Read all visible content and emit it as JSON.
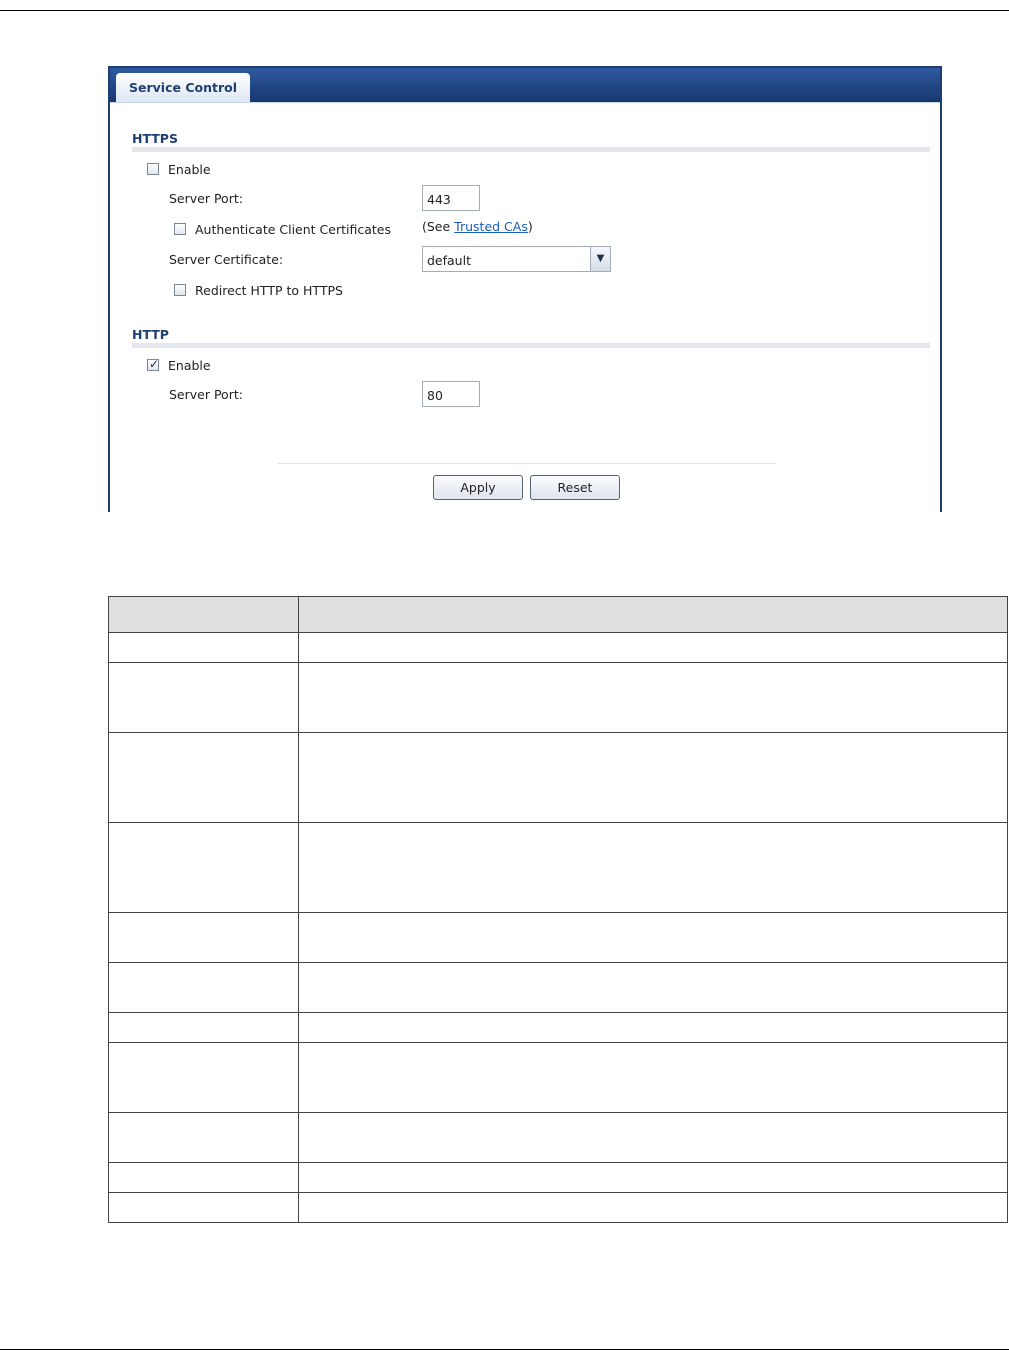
{
  "panel": {
    "tab_label": "Service Control",
    "https": {
      "title": "HTTPS",
      "enable_label": "Enable",
      "enable_checked": false,
      "server_port_label": "Server Port:",
      "server_port_value": "443",
      "auth_client_label": "Authenticate Client Certificates",
      "auth_client_checked": false,
      "see_prefix": "(See ",
      "trusted_cas_link": "Trusted CAs",
      "see_suffix": ")",
      "server_cert_label": "Server Certificate:",
      "server_cert_value": "default",
      "redirect_label": "Redirect HTTP to HTTPS",
      "redirect_checked": false
    },
    "http": {
      "title": "HTTP",
      "enable_label": "Enable",
      "enable_checked": true,
      "server_port_label": "Server Port:",
      "server_port_value": "80"
    },
    "buttons": {
      "apply": "Apply",
      "reset": "Reset"
    }
  },
  "icons": {
    "checkmark": "✓",
    "dropdown": "▼"
  },
  "colors": {
    "header_blue": "#1f3f73",
    "link_blue": "#1a5fc1"
  },
  "table": {
    "rows": [
      {
        "label": "",
        "desc": ""
      },
      {
        "label": "",
        "desc": ""
      },
      {
        "label": "",
        "desc": ""
      },
      {
        "label": "",
        "desc": ""
      },
      {
        "label": "",
        "desc": ""
      },
      {
        "label": "",
        "desc": ""
      },
      {
        "label": "",
        "desc": ""
      },
      {
        "label": "",
        "desc": ""
      },
      {
        "label": "",
        "desc": ""
      },
      {
        "label": "",
        "desc": ""
      },
      {
        "label": "",
        "desc": ""
      }
    ]
  }
}
